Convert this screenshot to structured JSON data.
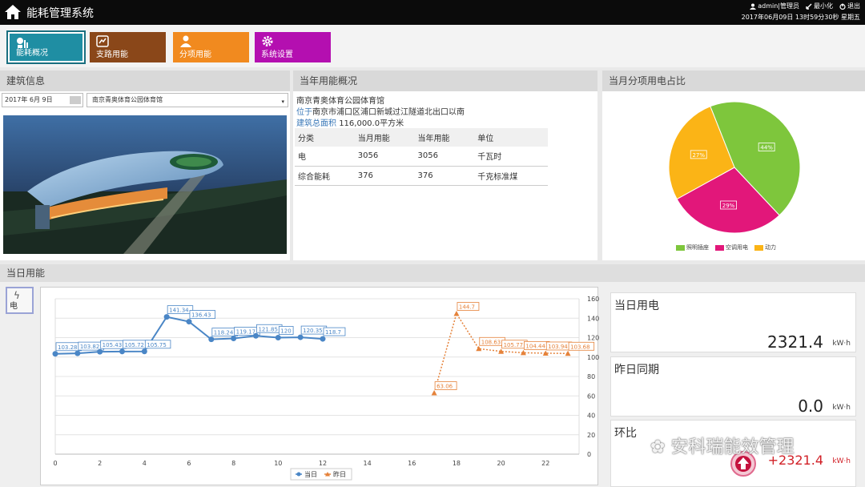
{
  "app": {
    "title": "能耗管理系统"
  },
  "topbar": {
    "user": "admin|管理员",
    "minimize": "最小化",
    "exit": "退出",
    "datetime": "2017年06月09日 13时59分30秒 星期五"
  },
  "nav": [
    {
      "label": "能耗概况",
      "icon": "dashboard-icon"
    },
    {
      "label": "支路用能",
      "icon": "branch-icon"
    },
    {
      "label": "分项用能",
      "icon": "user-icon"
    },
    {
      "label": "系统设置",
      "icon": "gear-icon"
    }
  ],
  "building": {
    "header": "建筑信息",
    "date": "2017年 6月 9日",
    "selected": "南京青奥体育公园体育馆"
  },
  "annual": {
    "header": "当年用能概况",
    "name": "南京青奥体育公园体育馆",
    "location_key": "位于",
    "location": "南京市浦口区浦口新城过江隧道北出口以南",
    "area_key": "建筑总面积",
    "area": "116,000.0平方米",
    "columns": [
      "分类",
      "当月用能",
      "当年用能",
      "单位"
    ],
    "rows": [
      [
        "电",
        "3056",
        "3056",
        "千瓦时"
      ],
      [
        "综合能耗",
        "376",
        "376",
        "千克标准煤"
      ]
    ]
  },
  "pie": {
    "header": "当月分项用电占比",
    "slices": [
      {
        "name": "照明插座",
        "value": 44,
        "label": "44%",
        "color": "#7ec63c"
      },
      {
        "name": "空调用电",
        "value": 29,
        "label": "29%",
        "color": "#e2177a"
      },
      {
        "name": "动力",
        "value": 27,
        "label": "27%",
        "color": "#fbb416"
      }
    ]
  },
  "daily": {
    "header": "当日用能",
    "energy_button": "电",
    "today_label": "当日用电",
    "today_value": "2321.4",
    "yesterday_label": "昨日同期",
    "yesterday_value": "0.0",
    "ratio_label": "环比",
    "ratio_value": "+2321.4",
    "unit": "kW·h",
    "watermark": "安科瑞能效管理"
  },
  "chart_data": {
    "type": "line",
    "x": [
      0,
      1,
      2,
      3,
      4,
      5,
      6,
      7,
      8,
      9,
      10,
      11,
      12,
      13,
      14,
      15,
      16,
      17,
      18,
      19,
      20,
      21,
      22,
      23
    ],
    "xticks": [
      0,
      2,
      4,
      6,
      8,
      10,
      12,
      14,
      16,
      18,
      20,
      22
    ],
    "ylim": [
      0,
      160
    ],
    "yticks": [
      0,
      20,
      40,
      60,
      80,
      100,
      120,
      140,
      160
    ],
    "series": [
      {
        "name": "当日",
        "color": "#4a86c6",
        "values": [
          103.28,
          103.82,
          105.43,
          105.72,
          105.75,
          141.34,
          136.43,
          118.24,
          119.17,
          121.85,
          120.0,
          120.35,
          118.7,
          null,
          null,
          null,
          null,
          null,
          null,
          null,
          null,
          null,
          null,
          null
        ]
      },
      {
        "name": "昨日",
        "color": "#e5823a",
        "values": [
          null,
          null,
          null,
          null,
          null,
          null,
          null,
          null,
          null,
          null,
          null,
          null,
          null,
          null,
          null,
          null,
          null,
          63.06,
          144.7,
          108.63,
          105.77,
          104.44,
          103.94,
          103.68
        ]
      }
    ]
  }
}
